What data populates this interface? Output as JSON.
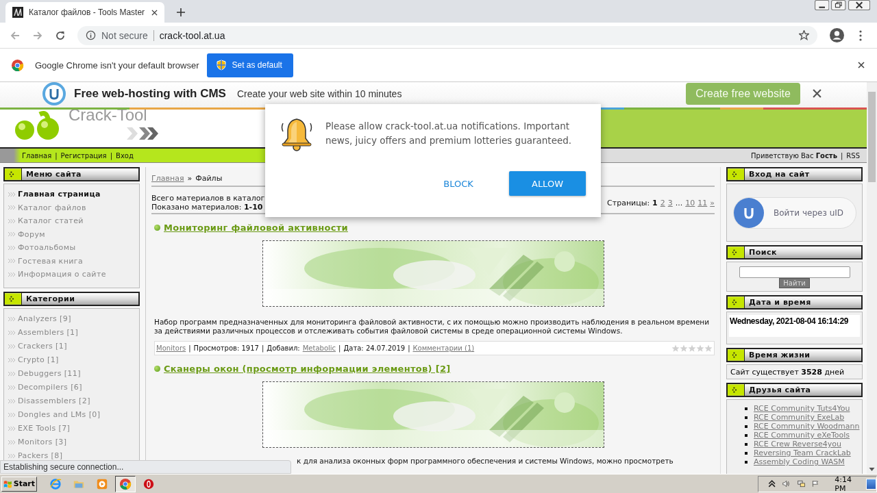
{
  "browser": {
    "tab": {
      "title": "Каталог файлов - Tools Master"
    },
    "security": "Not secure",
    "url": "crack-tool.at.ua"
  },
  "infobar": {
    "message": "Google Chrome isn't your default browser",
    "button": "Set as default"
  },
  "ad": {
    "title": "Free web-hosting with CMS",
    "subtitle": "Create your web site within 10 minutes",
    "button": "Create free website"
  },
  "site": {
    "logo": "Crack-Tool",
    "nav": {
      "links": [
        "Главная",
        "Регистрация",
        "Вход"
      ],
      "separator": "|",
      "greeting": "Приветствую Вас **Гость**",
      "rss": "RSS"
    }
  },
  "menu": {
    "title": "Меню сайта",
    "items": [
      {
        "label": "Главная страница",
        "selected": true
      },
      {
        "label": "Каталог файлов",
        "selected": false
      },
      {
        "label": "Каталог статей",
        "selected": false
      },
      {
        "label": "Форум",
        "selected": false
      },
      {
        "label": "Фотоальбомы",
        "selected": false
      },
      {
        "label": "Гостевая книга",
        "selected": false
      },
      {
        "label": "Информация о сайте",
        "selected": false
      }
    ]
  },
  "categories": {
    "title": "Категории",
    "items": [
      "Analyzers [9]",
      "Assemblers [1]",
      "Crackers [1]",
      "Crypto [1]",
      "Debuggers [11]",
      "Decompilers [6]",
      "Disassemblers [2]",
      "Dongles and LMs [0]",
      "EXE Tools [7]",
      "Monitors [3]",
      "Packers [8]"
    ]
  },
  "content": {
    "breadcrumb": {
      "home": "Главная",
      "separator": "»",
      "current": "Файлы"
    },
    "summary": [
      "Всего материалов в каталог",
      "Показано материалов: **1-10**"
    ],
    "pagination": {
      "label": "Страницы:",
      "items": [
        {
          "label": "1",
          "kind": "page",
          "selected": true
        },
        {
          "label": "2",
          "kind": "page",
          "selected": false
        },
        {
          "label": "3",
          "kind": "page",
          "selected": false
        },
        {
          "label": "...",
          "kind": "gap"
        },
        {
          "label": "10",
          "kind": "page",
          "selected": false
        },
        {
          "label": "11",
          "kind": "page",
          "selected": false
        },
        {
          "label": "»",
          "kind": "page",
          "selected": false
        }
      ]
    },
    "entries": [
      {
        "title": "Мониторинг файловой активности",
        "description": "Набор программ предназначенных для мониторинга файловой активности, с их помощью можно производить наблюдения в реальном времени за действиями различных процессов и отслеживать события файловой системы в среде операционной системы Windows.",
        "meta": {
          "category": "Monitors",
          "separator": "|",
          "views": "Просмотров: 1917",
          "author_label": "Добавил:",
          "author": "Metabolic",
          "date": "Дата: 24.07.2019",
          "comments": "Комментарии (1)",
          "stars": 0
        }
      },
      {
        "title": "Сканеры окон (просмотр информации элементов) [2]",
        "description": "к для анализа оконных форм программного обеспечения и системы Windows, можно просмотреть"
      }
    ]
  },
  "login": {
    "title": "Вход на сайт",
    "button": "Войти через uID"
  },
  "search": {
    "title": "Поиск",
    "button": "Найти"
  },
  "datetime": {
    "title": "Дата и время",
    "value": "Wednesday, 2021-08-04 16:14:29"
  },
  "life": {
    "title": "Время жизни",
    "text": "Сайт существует **3528** дней"
  },
  "friends": {
    "title": "Друзья сайта",
    "links": [
      "RCE Community Tuts4You",
      "RCE Community ExeLab",
      "RCE Community Woodmann",
      "RCE Community eXeTools",
      "RCE Crew Reverse4you",
      "Reversing Team CrackLab",
      "Assembly Coding WASM"
    ]
  },
  "popup": {
    "text": "Please allow crack-tool.at.ua notifications. Important news, juicy offers and premium lotteries guaranteed.",
    "block": "BLOCK",
    "allow": "ALLOW"
  },
  "status": "Establishing secure connection...",
  "taskbar": {
    "start": "Start",
    "apps": [
      {
        "kind": "ie",
        "selected": false
      },
      {
        "kind": "folder",
        "selected": false
      },
      {
        "kind": "media",
        "selected": false
      },
      {
        "kind": "chrome",
        "selected": true
      },
      {
        "kind": "opera",
        "selected": false
      }
    ],
    "time": "4:14 PM"
  }
}
